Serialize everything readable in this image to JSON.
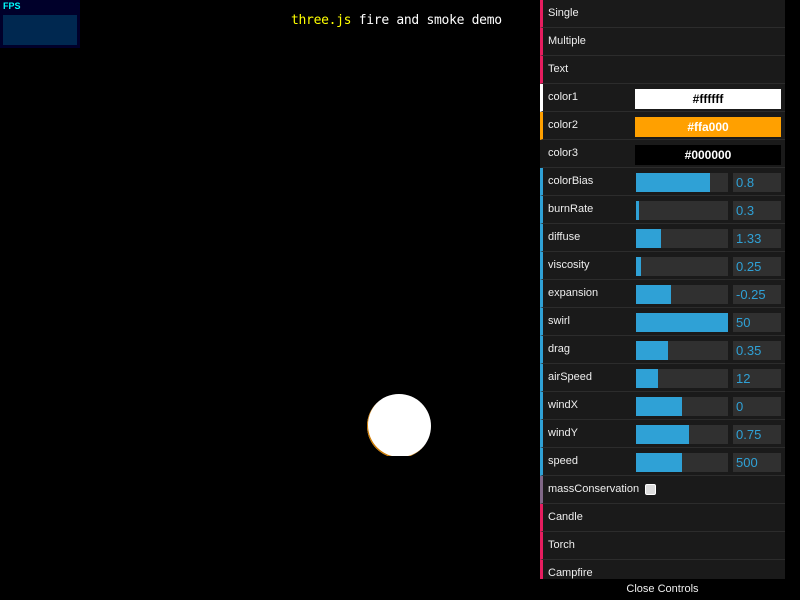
{
  "fps": {
    "label": "FPS"
  },
  "title": {
    "link_text": "three.js",
    "rest": " fire and smoke demo"
  },
  "gui": {
    "rows": [
      {
        "type": "function",
        "label": "Single"
      },
      {
        "type": "function",
        "label": "Multiple"
      },
      {
        "type": "function",
        "label": "Text"
      },
      {
        "type": "color",
        "label": "color1",
        "value": "#ffffff",
        "bg": "#ffffff",
        "fg": "#000000",
        "accent": "#ffffff"
      },
      {
        "type": "color",
        "label": "color2",
        "value": "#ffa000",
        "bg": "#ffa000",
        "fg": "#ffffff",
        "accent": "#ffa000"
      },
      {
        "type": "color",
        "label": "color3",
        "value": "#000000",
        "bg": "#000000",
        "fg": "#ffffff",
        "accent": "#1a1a1a"
      },
      {
        "type": "number",
        "label": "colorBias",
        "value": "0.8",
        "fill": 0.8
      },
      {
        "type": "number",
        "label": "burnRate",
        "value": "0.3",
        "fill": 0.03
      },
      {
        "type": "number",
        "label": "diffuse",
        "value": "1.33",
        "fill": 0.27
      },
      {
        "type": "number",
        "label": "viscosity",
        "value": "0.25",
        "fill": 0.05
      },
      {
        "type": "number",
        "label": "expansion",
        "value": "-0.25",
        "fill": 0.38
      },
      {
        "type": "number",
        "label": "swirl",
        "value": "50",
        "fill": 1.0
      },
      {
        "type": "number",
        "label": "drag",
        "value": "0.35",
        "fill": 0.35
      },
      {
        "type": "number",
        "label": "airSpeed",
        "value": "12",
        "fill": 0.24
      },
      {
        "type": "number",
        "label": "windX",
        "value": "0",
        "fill": 0.5
      },
      {
        "type": "number",
        "label": "windY",
        "value": "0.75",
        "fill": 0.575
      },
      {
        "type": "number",
        "label": "speed",
        "value": "500",
        "fill": 0.5
      },
      {
        "type": "boolean",
        "label": "massConservation",
        "checked": false
      },
      {
        "type": "function",
        "label": "Candle"
      },
      {
        "type": "function",
        "label": "Torch"
      },
      {
        "type": "function",
        "label": "Campfire"
      }
    ],
    "close_label": "Close Controls"
  }
}
